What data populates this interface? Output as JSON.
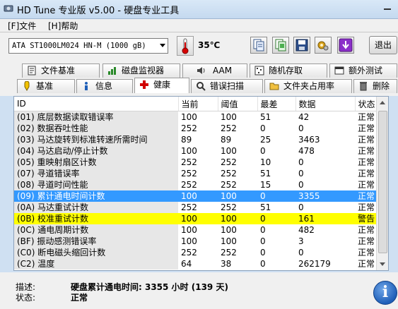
{
  "window": {
    "title": "HD Tune 专业版 v5.00 - 硬盘专业工具"
  },
  "menu": {
    "file": "[F]文件",
    "help": "[H]帮助"
  },
  "toolbar": {
    "drive": "ATA    ST1000LM024 HN-M (1000 gB)",
    "temperature": "35℃",
    "exit_label": "退出",
    "icons": [
      "copy-text-icon",
      "copy-screenshot-icon",
      "save-icon",
      "options-icon",
      "minimize-tray-icon"
    ]
  },
  "tabs_row1": [
    {
      "label": "文件基准",
      "icon": "file-benchmark-icon"
    },
    {
      "label": "磁盘监视器",
      "icon": "disk-monitor-icon"
    },
    {
      "label": "AAM",
      "icon": "speaker-icon"
    },
    {
      "label": "随机存取",
      "icon": "random-access-icon"
    },
    {
      "label": "额外测试",
      "icon": "extra-tests-icon"
    }
  ],
  "tabs_row2": [
    {
      "label": "基准",
      "icon": "benchmark-icon"
    },
    {
      "label": "信息",
      "icon": "info-small-icon"
    },
    {
      "label": "健康",
      "icon": "health-cross-icon",
      "active": true
    },
    {
      "label": "错误扫描",
      "icon": "error-scan-icon"
    },
    {
      "label": "文件夹占用率",
      "icon": "folder-usage-icon"
    },
    {
      "label": "删除",
      "icon": "erase-icon"
    }
  ],
  "table": {
    "columns": [
      "ID",
      "当前",
      "阈值",
      "最差",
      "数据",
      "状态"
    ],
    "rows": [
      {
        "id": "(01) 底层数据读取错误率",
        "current": "100",
        "threshold": "100",
        "worst": "51",
        "data": "42",
        "status": "正常",
        "state": "normal"
      },
      {
        "id": "(02) 数据吞吐性能",
        "current": "252",
        "threshold": "252",
        "worst": "0",
        "data": "0",
        "status": "正常",
        "state": "normal"
      },
      {
        "id": "(03) 马达旋转到标准转速所需时间",
        "current": "89",
        "threshold": "89",
        "worst": "25",
        "data": "3463",
        "status": "正常",
        "state": "normal"
      },
      {
        "id": "(04) 马达启动/停止计数",
        "current": "100",
        "threshold": "100",
        "worst": "0",
        "data": "478",
        "status": "正常",
        "state": "normal"
      },
      {
        "id": "(05) 重映射扇区计数",
        "current": "252",
        "threshold": "252",
        "worst": "10",
        "data": "0",
        "status": "正常",
        "state": "normal"
      },
      {
        "id": "(07) 寻道错误率",
        "current": "252",
        "threshold": "252",
        "worst": "51",
        "data": "0",
        "status": "正常",
        "state": "normal"
      },
      {
        "id": "(08) 寻道时间性能",
        "current": "252",
        "threshold": "252",
        "worst": "15",
        "data": "0",
        "status": "正常",
        "state": "normal"
      },
      {
        "id": "(09) 累计通电时间计数",
        "current": "100",
        "threshold": "100",
        "worst": "0",
        "data": "3355",
        "status": "正常",
        "state": "selected"
      },
      {
        "id": "(0A) 马达重试计数",
        "current": "252",
        "threshold": "252",
        "worst": "51",
        "data": "0",
        "status": "正常",
        "state": "normal"
      },
      {
        "id": "(0B) 校准重试计数",
        "current": "100",
        "threshold": "100",
        "worst": "0",
        "data": "161",
        "status": "警告",
        "state": "warning"
      },
      {
        "id": "(0C) 通电周期计数",
        "current": "100",
        "threshold": "100",
        "worst": "0",
        "data": "482",
        "status": "正常",
        "state": "normal"
      },
      {
        "id": "(BF) 振动感测错误率",
        "current": "100",
        "threshold": "100",
        "worst": "0",
        "data": "3",
        "status": "正常",
        "state": "normal"
      },
      {
        "id": "(C0) 断电磁头缩回计数",
        "current": "252",
        "threshold": "252",
        "worst": "0",
        "data": "0",
        "status": "正常",
        "state": "normal"
      },
      {
        "id": "(C2) 温度",
        "current": "64",
        "threshold": "38",
        "worst": "0",
        "data": "262179",
        "status": "正常",
        "state": "normal"
      }
    ]
  },
  "status": {
    "description_label": "描述:",
    "description_value": "硬盘累计通电时间: 3355 小时 (139 天)",
    "state_label": "状态:",
    "state_value": "正常"
  }
}
